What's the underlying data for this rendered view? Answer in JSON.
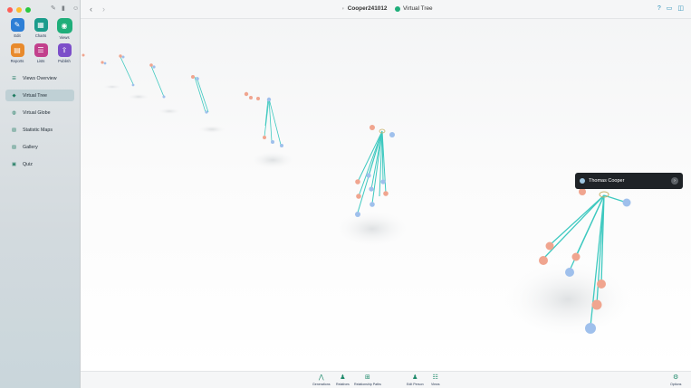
{
  "window": {
    "document_title": "Cooper241012",
    "view_title": "Virtual Tree"
  },
  "modes": [
    {
      "label": "Edit",
      "icon": "pencil-icon",
      "color": "#2d7fd6"
    },
    {
      "label": "Charts",
      "icon": "charts-icon",
      "color": "#1b9c8c"
    },
    {
      "label": "Views",
      "icon": "eye-icon",
      "color": "#1fae7a"
    },
    {
      "label": "Reports",
      "icon": "reports-icon",
      "color": "#e88a2c"
    },
    {
      "label": "Lists",
      "icon": "lists-icon",
      "color": "#c2408c"
    },
    {
      "label": "Publish",
      "icon": "publish-icon",
      "color": "#7c4fc9"
    }
  ],
  "nav": [
    {
      "label": "Views Overview",
      "icon": "list-icon"
    },
    {
      "label": "Virtual Tree",
      "icon": "cube-icon"
    },
    {
      "label": "Virtual Globe",
      "icon": "globe-icon"
    },
    {
      "label": "Statistic Maps",
      "icon": "map-icon"
    },
    {
      "label": "Gallery",
      "icon": "gallery-icon"
    },
    {
      "label": "Quiz",
      "icon": "quiz-icon"
    }
  ],
  "popup": {
    "name": "Thomas Cooper"
  },
  "bottom": [
    {
      "label": "Generations",
      "icon": "generations-icon"
    },
    {
      "label": "Relatives",
      "icon": "relatives-icon"
    },
    {
      "label": "Relationship Paths",
      "icon": "relationship-paths-icon"
    },
    {
      "label": "Edit Person",
      "icon": "edit-person-icon"
    },
    {
      "label": "Views",
      "icon": "views-icon"
    },
    {
      "label": "Options",
      "icon": "options-icon"
    }
  ],
  "colors": {
    "accent": "#1fae7a",
    "link_line": "#3ec9c0",
    "male": "#9fc0ec",
    "female": "#f0a58f"
  }
}
